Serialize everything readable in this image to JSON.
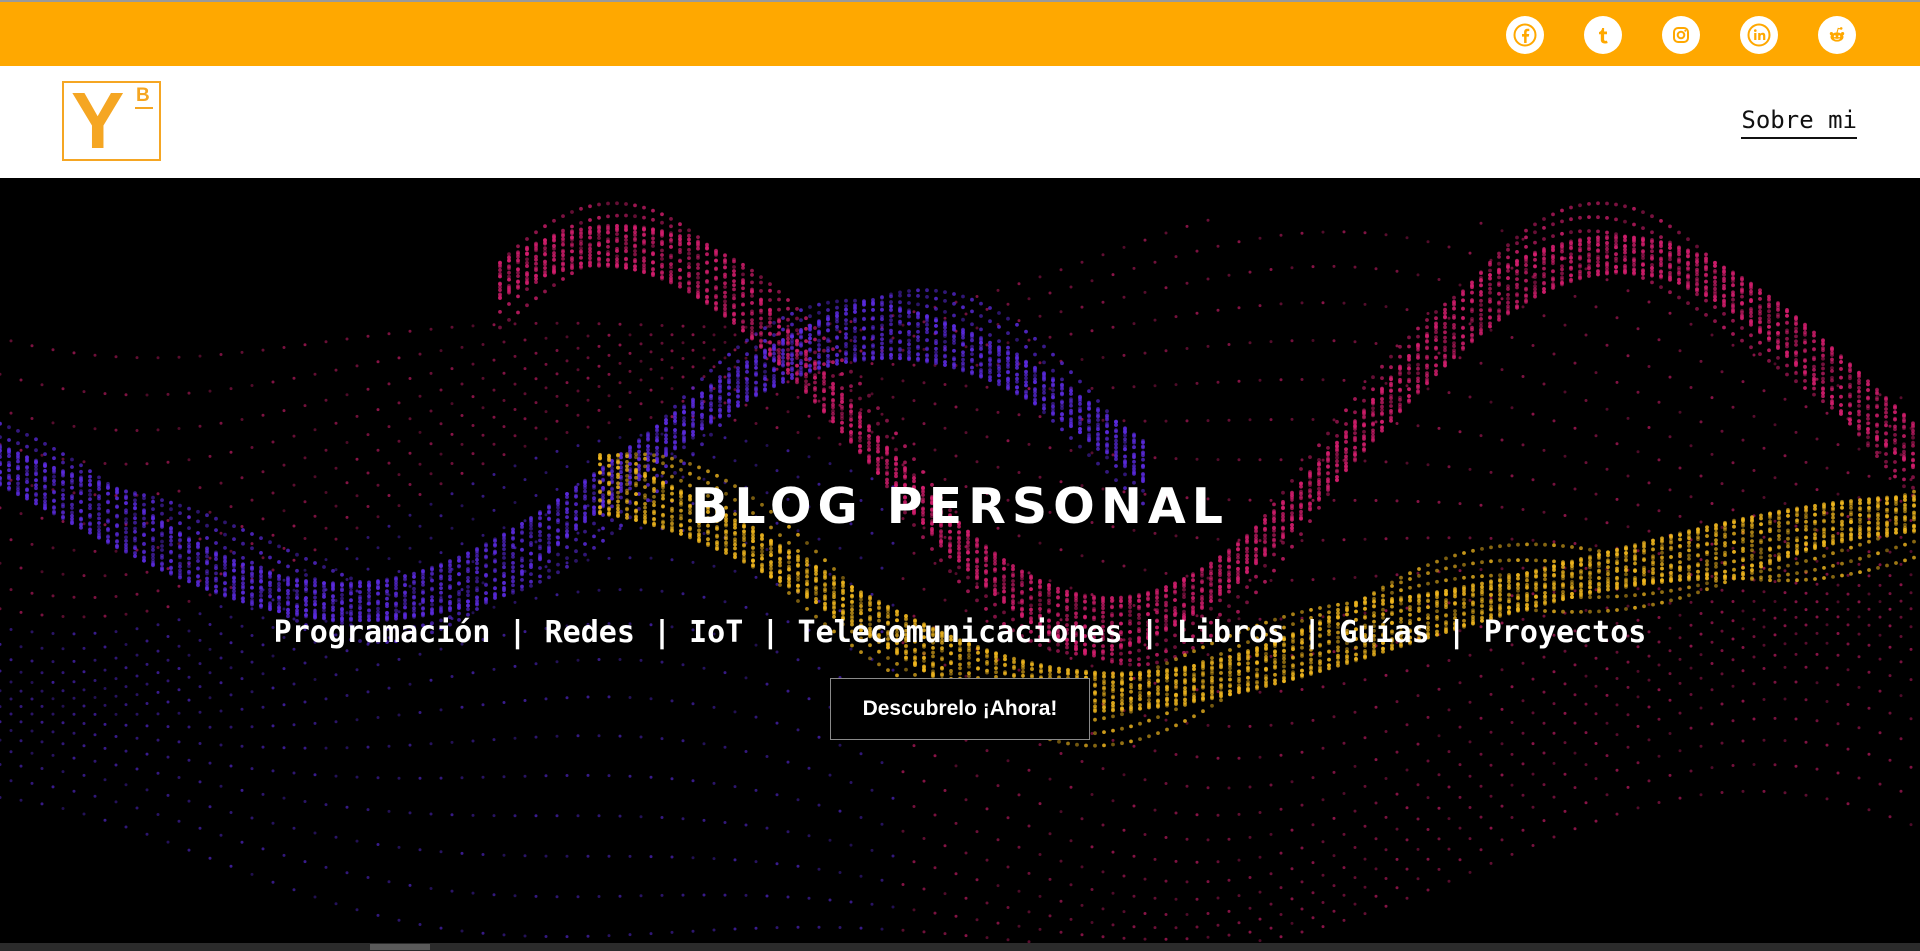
{
  "topbar": {
    "color": "#FFA800",
    "social_icons": [
      "facebook-icon",
      "tumblr-icon",
      "instagram-icon",
      "linkedin-icon",
      "reddit-icon"
    ]
  },
  "header": {
    "logo": {
      "letter": "Y",
      "superscript": "B",
      "color": "#F5A623"
    },
    "nav": {
      "about_label": "Sobre mi"
    }
  },
  "hero": {
    "title": "BLOG PERSONAL",
    "categories": "Programación | Redes | IoT | Telecomunicaciones | Libros | Guías | Proyectos",
    "cta_label": "Descubrelo ¡Ahora!",
    "background": "dotted-particle-waves",
    "palette": [
      "#5B2BE0",
      "#D41E6E",
      "#F2B81F"
    ]
  }
}
